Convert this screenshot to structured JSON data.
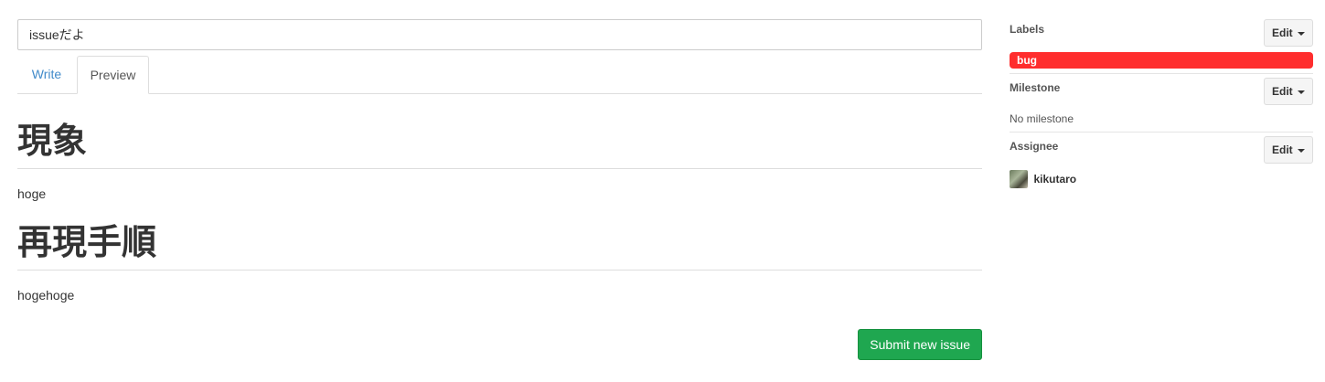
{
  "issue": {
    "title_value": "issueだよ"
  },
  "tabs": [
    {
      "label": "Write",
      "active": false
    },
    {
      "label": "Preview",
      "active": true
    }
  ],
  "preview": {
    "heading1": "現象",
    "paragraph1": "hoge",
    "heading2": "再現手順",
    "paragraph2": "hogehoge"
  },
  "submit": {
    "label": "Submit new issue",
    "color": "#1fa750"
  },
  "sidebar": {
    "labels": {
      "title": "Labels",
      "edit_label": "Edit",
      "items": [
        {
          "name": "bug",
          "color": "#ff2d2d"
        }
      ]
    },
    "milestone": {
      "title": "Milestone",
      "edit_label": "Edit",
      "value": "No milestone"
    },
    "assignee": {
      "title": "Assignee",
      "edit_label": "Edit",
      "name": "kikutaro",
      "avatar_icon": "user-avatar"
    }
  },
  "colors": {
    "link": "#428bca",
    "border": "#dddddd"
  }
}
